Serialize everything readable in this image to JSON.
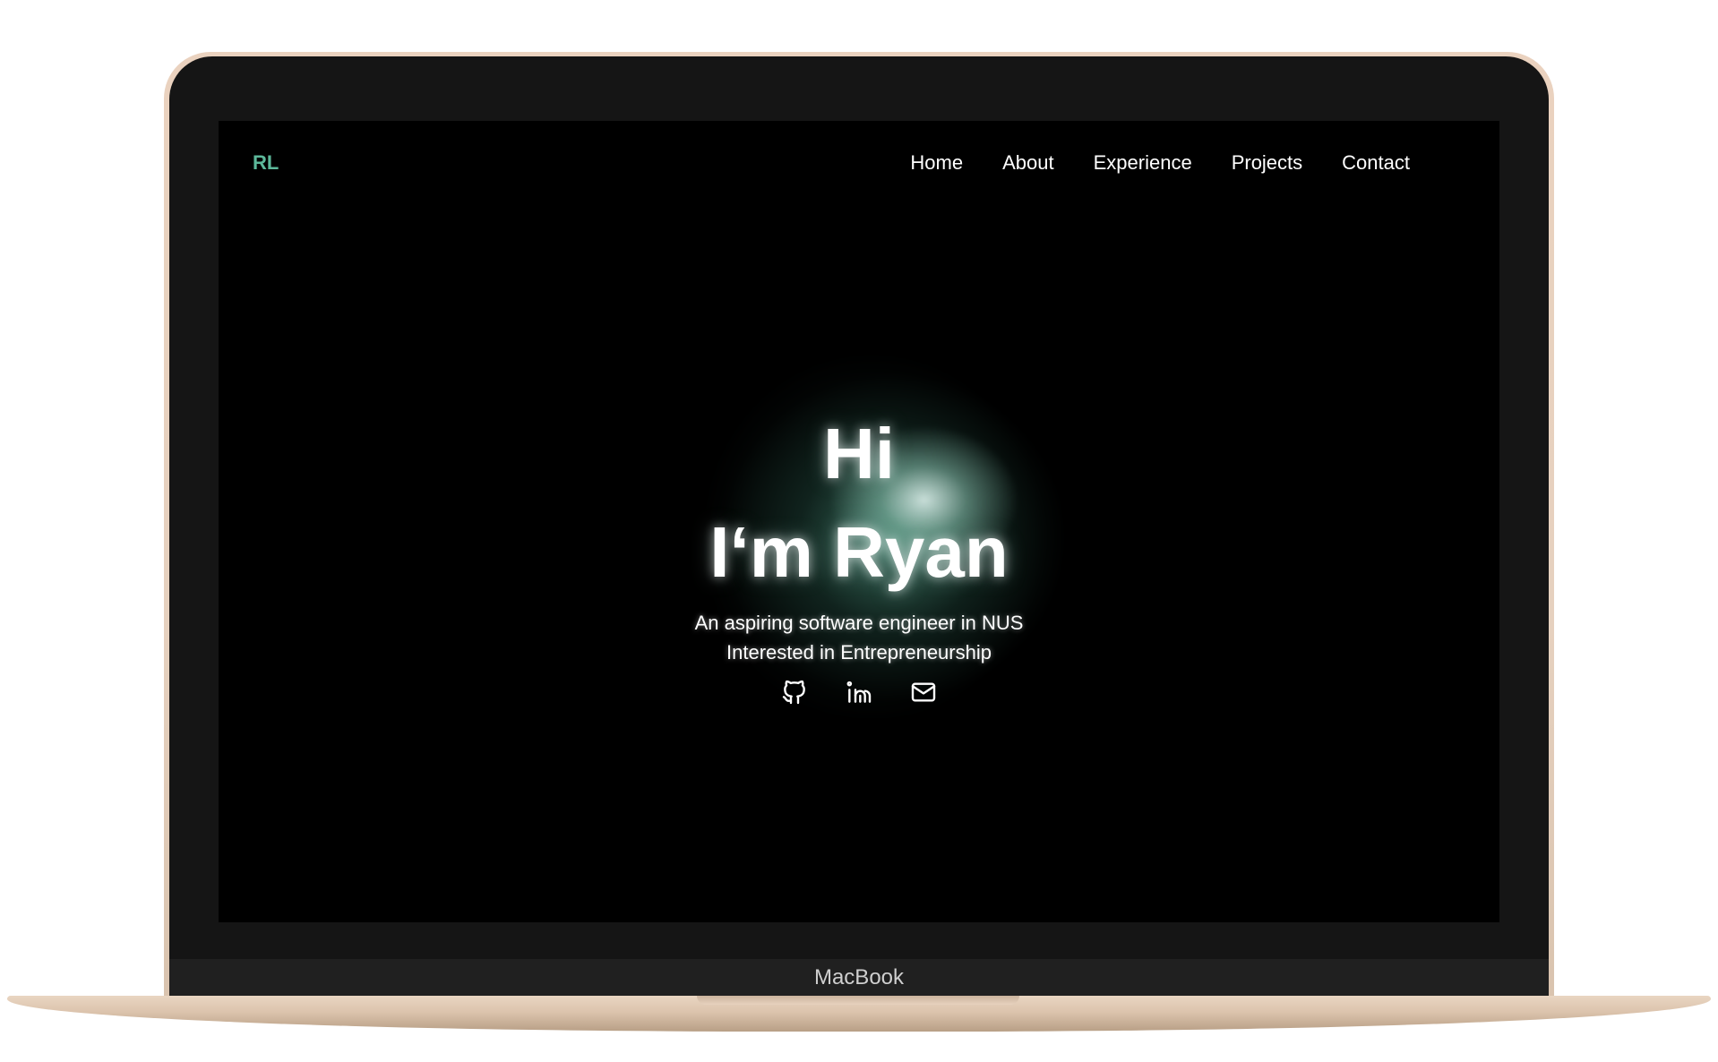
{
  "device": {
    "brand_label": "MacBook"
  },
  "header": {
    "logo": "RL",
    "nav": [
      {
        "label": "Home"
      },
      {
        "label": "About"
      },
      {
        "label": "Experience"
      },
      {
        "label": "Projects"
      },
      {
        "label": "Contact"
      }
    ]
  },
  "hero": {
    "greeting": "Hi",
    "name_line": "I‘m Ryan",
    "subtitle_1": "An aspiring software engineer in NUS",
    "subtitle_2": "Interested in Entrepreneurship",
    "socials": [
      {
        "icon": "github-icon"
      },
      {
        "icon": "linkedin-icon"
      },
      {
        "icon": "mail-icon"
      }
    ]
  },
  "colors": {
    "accent": "#5cb89a",
    "background": "#000000",
    "text": "#ffffff"
  }
}
